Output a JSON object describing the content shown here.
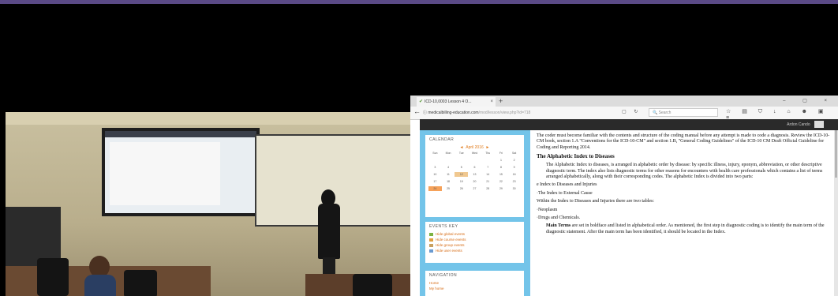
{
  "browser": {
    "tab_title": "ICD-10,0003 Lesson 4 O...",
    "tab_close": "×",
    "new_tab": "+",
    "window_controls": "– ▢ ×",
    "url_host": "medicalbilling-education.com",
    "url_path": "/mod/lesson/view.php?id=718",
    "search_placeholder": "Search"
  },
  "site": {
    "user_label": "Ardon Cando"
  },
  "calendar": {
    "title": "CALENDAR",
    "month": "April 2016",
    "prev": "◄",
    "next": "►",
    "weekdays": [
      "Sun",
      "Mon",
      "Tue",
      "Wed",
      "Thu",
      "Fri",
      "Sat"
    ],
    "days": [
      "",
      "",
      "",
      "",
      "",
      "1",
      "2",
      "3",
      "4",
      "5",
      "6",
      "7",
      "8",
      "9",
      "10",
      "11",
      "12",
      "13",
      "14",
      "15",
      "16",
      "17",
      "18",
      "19",
      "20",
      "21",
      "22",
      "23",
      "24",
      "25",
      "26",
      "27",
      "28",
      "29",
      "30"
    ]
  },
  "events_key": {
    "title": "EVENTS KEY",
    "items": [
      "Hide global events",
      "Hide course events",
      "Hide group events",
      "Hide user events"
    ]
  },
  "navigation": {
    "title": "NAVIGATION",
    "items": [
      "Home",
      "My home"
    ]
  },
  "content": {
    "intro": "The coder must become familiar with the contents and structure of the coding manual before any attempt is made to code a diagnosis. Review the ICD-10-CM book, section 1.A \"Conventions for the ICD-10-CM\" and section 1.B, \"General Coding Guidelines\" of the ICD-10 CM Draft Official Guideline for Coding and Reporting 2014.",
    "heading": "The Alphabetic Index to Diseases",
    "index_para": "The Alphabetic Index to diseases, is arranged in alphabetic order by disease: by specific illness, injury, eponym, abbreviation, or other descriptive diagnostic term. The index also lists diagnostic terms for other reasons for encounters with health care professionals which contains a list of terms arranged alphabetically, along with their corresponding codes. The alphabetic Index is divided into two parts:",
    "list_1": "e Index to Diseases and Injuries",
    "list_2": "·The Index to External Cause",
    "tables_intro": "Within the Index to Diseases and Injuries there are two tables:",
    "table_1": "·Neoplasm",
    "table_2": "·Drugs and Chemicals.",
    "main_terms_label": "Main Terms",
    "main_terms_text": " are set in boldface and listed in alphabetical order. As mentioned, the first step in diagnostic coding is to identify the main term of the diagnostic statement. After the main term has been identified, it should be located in the Index."
  },
  "colors": {
    "top_bar": "#5a4a86",
    "sidebar_blue": "#73c4e9",
    "link_orange": "#d66b14"
  }
}
